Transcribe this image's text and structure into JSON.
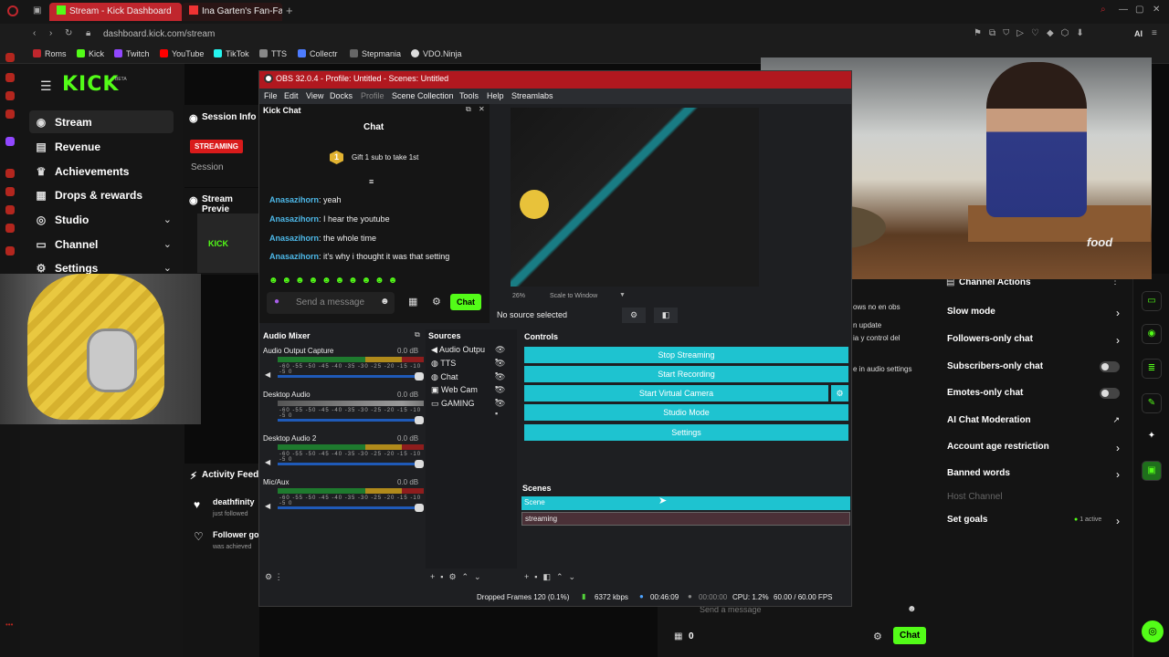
{
  "browser": {
    "tabs": [
      {
        "label": "Stream - Kick Dashboard"
      },
      {
        "label": "Ina Garten's Fan-Favor"
      }
    ],
    "url": "dashboard.kick.com/stream",
    "bookmarks": [
      "Roms",
      "Kick",
      "Twitch",
      "YouTube",
      "TikTok",
      "TTS",
      "Collectr",
      "Stepmania",
      "VDO.Ninja"
    ],
    "ai_label": "AI"
  },
  "kick": {
    "logo": "KICK",
    "beta": "BETA",
    "nav": [
      {
        "label": "Stream",
        "icon": "stream-icon"
      },
      {
        "label": "Revenue",
        "icon": "revenue-icon"
      },
      {
        "label": "Achievements",
        "icon": "trophy-icon"
      },
      {
        "label": "Drops & rewards",
        "icon": "gift-icon"
      },
      {
        "label": "Studio",
        "icon": "studio-icon"
      },
      {
        "label": "Channel",
        "icon": "channel-icon"
      },
      {
        "label": "Settings",
        "icon": "gear-icon"
      }
    ],
    "session_info": "Session Info",
    "streaming_badge": "STREAMING",
    "session_label": "Session",
    "stream_preview": "Stream Previe",
    "activity_feed": "Activity Feed",
    "activity": [
      {
        "name": "deathfinity",
        "sub": "just followed"
      },
      {
        "name": "Follower go",
        "sub": "was achieved"
      }
    ],
    "behind_text": [
      "ows no en obs",
      "n update",
      "ia y control del",
      "e in audio settings"
    ],
    "send_placeholder": "Send a message",
    "chat_button": "Chat",
    "bottom_count": "0"
  },
  "channel_actions": {
    "title": "Channel Actions",
    "items": [
      {
        "label": "Slow mode",
        "control": "chevron"
      },
      {
        "label": "Followers-only chat",
        "control": "chevron"
      },
      {
        "label": "Subscribers-only chat",
        "control": "toggle"
      },
      {
        "label": "Emotes-only chat",
        "control": "toggle"
      },
      {
        "label": "AI Chat Moderation",
        "control": "external"
      },
      {
        "label": "Account age restriction",
        "control": "chevron"
      },
      {
        "label": "Banned words",
        "control": "chevron"
      },
      {
        "label": "Host Channel",
        "control": "none"
      },
      {
        "label": "Set goals",
        "control": "chevron"
      }
    ],
    "goals_status": "1 active"
  },
  "obs": {
    "title": "OBS 32.0.4 - Profile: Untitled - Scenes: Untitled",
    "menu": [
      "File",
      "Edit",
      "View",
      "Docks",
      "Profile",
      "Scene Collection",
      "Tools",
      "Help",
      "Streamlabs"
    ],
    "kick_chat_dock": "Kick Chat",
    "chat_header": "Chat",
    "gift_text": "Gift 1 sub to take 1st",
    "gift_rank": "1",
    "messages": [
      {
        "user": "Anasazihorn",
        "text": ": yeah"
      },
      {
        "user": "Anasazihorn",
        "text": ": I hear the youtube"
      },
      {
        "user": "Anasazihorn",
        "text": ": the whole time"
      },
      {
        "user": "Anasazihorn",
        "text": ": it's why i thought it was that setting"
      }
    ],
    "send_placeholder": "Send a message",
    "chat_button": "Chat",
    "zoom": "26%",
    "scale_mode": "Scale to Window",
    "no_source": "No source selected",
    "audio_mixer": {
      "title": "Audio Mixer",
      "channels": [
        {
          "name": "Audio Output Capture",
          "db": "0.0 dB"
        },
        {
          "name": "Desktop Audio",
          "db": "0.0 dB"
        },
        {
          "name": "Desktop Audio 2",
          "db": "0.0 dB"
        },
        {
          "name": "Mic/Aux",
          "db": "0.0 dB"
        }
      ],
      "scale": "-60 -55 -50 -45 -40 -35 -30 -25 -20 -15 -10 -5 0"
    },
    "sources": {
      "title": "Sources",
      "items": [
        "Audio Outpu",
        "TTS",
        "Chat",
        "Web Cam",
        "GAMING"
      ]
    },
    "controls": {
      "title": "Controls",
      "buttons": [
        "Stop Streaming",
        "Start Recording",
        "Start Virtual Camera",
        "Studio Mode",
        "Settings"
      ]
    },
    "scenes": {
      "title": "Scenes",
      "items": [
        "Scene",
        "streaming"
      ]
    },
    "status": {
      "dropped": "Dropped Frames 120 (0.1%)",
      "bitrate": "6372 kbps",
      "stream_time": "00:46:09",
      "rec_time": "00:00:00",
      "cpu": "CPU: 1.2%",
      "fps": "60.00 / 60.00 FPS"
    }
  },
  "food_video": {
    "watermark": "food"
  }
}
